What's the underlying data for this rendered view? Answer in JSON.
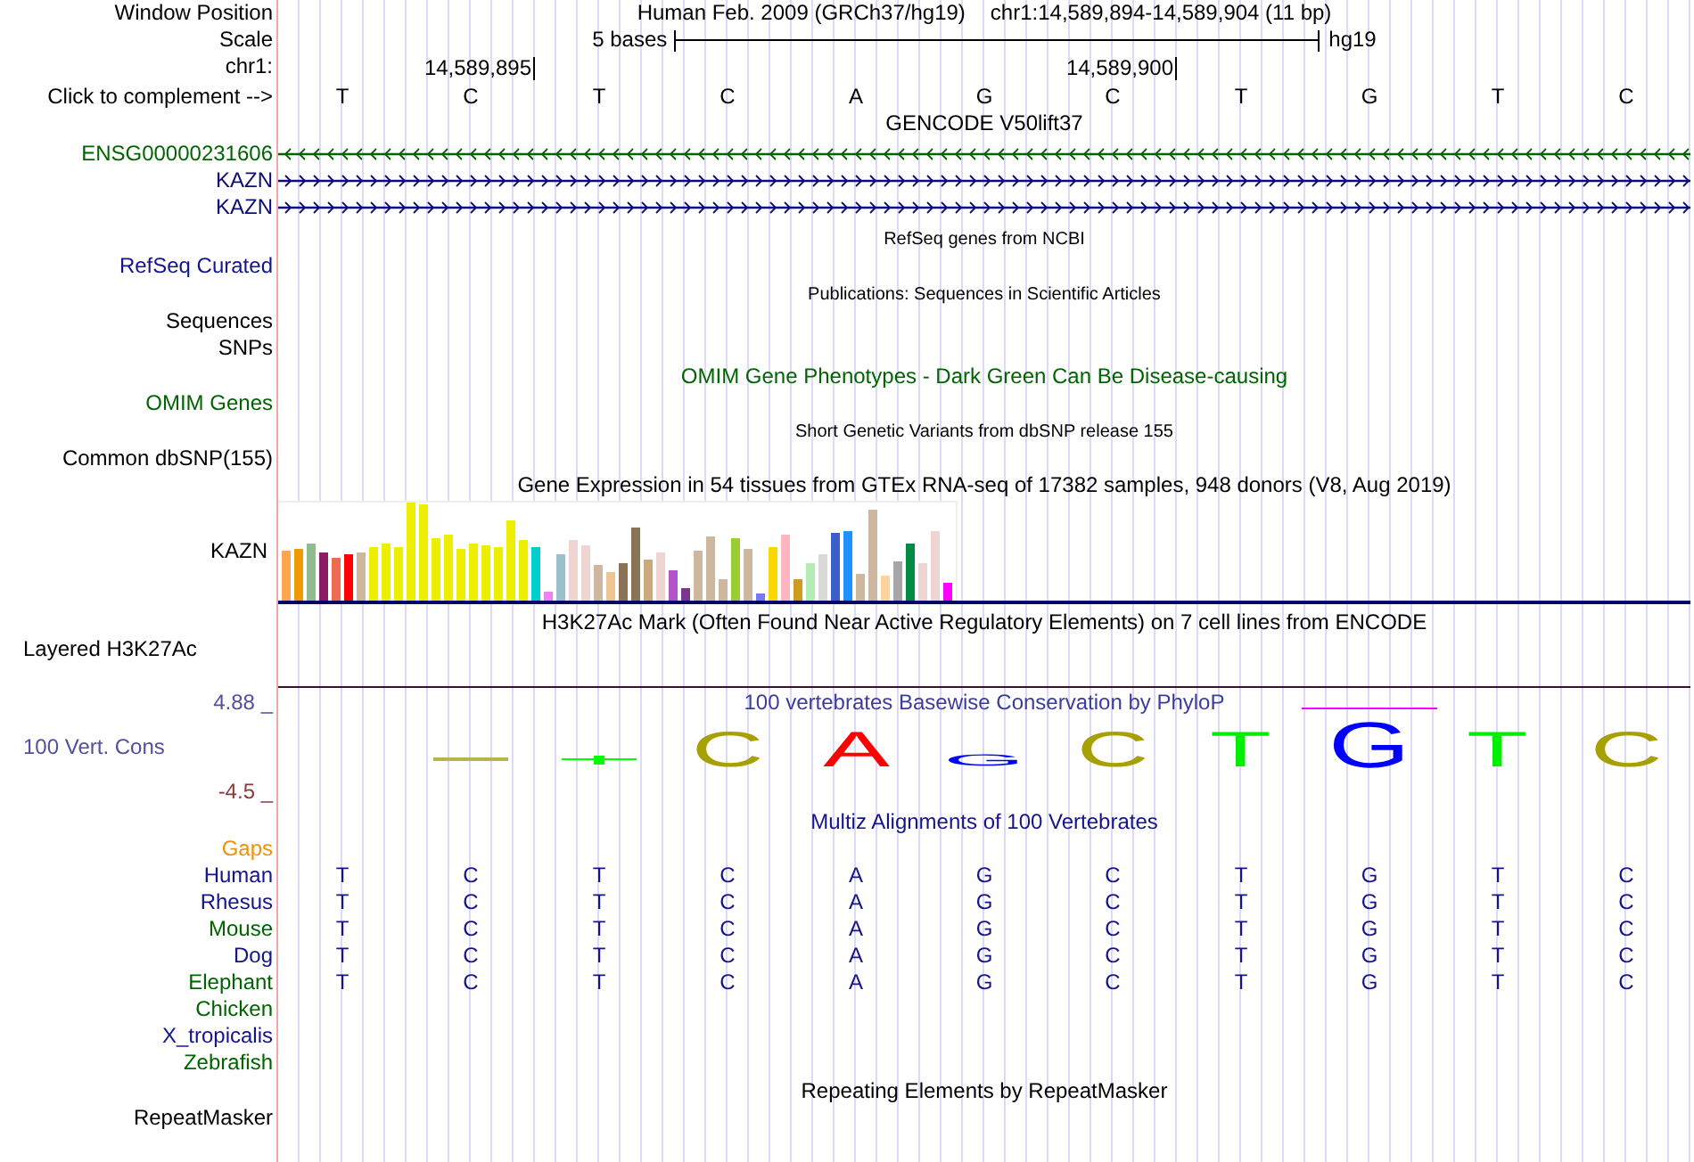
{
  "header": {
    "position_label": "Window Position",
    "assembly": "Human Feb. 2009 (GRCh37/hg19)",
    "position": "chr1:14,589,894-14,589,904 (11 bp)",
    "scale_label": "Scale",
    "scale_text": "5 bases",
    "scale_assembly": "hg19",
    "chrom_label": "chr1:",
    "ticks": [
      "14,589,895",
      "14,589,900"
    ],
    "complement_label": "Click to complement -->",
    "bases": [
      "T",
      "C",
      "T",
      "C",
      "A",
      "G",
      "C",
      "T",
      "G",
      "T",
      "C"
    ]
  },
  "tracks": [
    {
      "kind": "genes",
      "title": "GENCODE V50lift37",
      "genes": [
        {
          "name": "ENSG00000231606",
          "reverse": true,
          "color": "#006400"
        },
        {
          "name": "KAZN",
          "reverse": false,
          "color": "#0c0c78"
        },
        {
          "name": "KAZN",
          "reverse": false,
          "color": "#0c0c78"
        }
      ]
    },
    {
      "kind": "compact",
      "title": "RefSeq genes from NCBI",
      "labels": [
        {
          "text": "RefSeq Curated",
          "color": "#14148c"
        }
      ]
    },
    {
      "kind": "compact",
      "title": "Publications: Sequences in Scientific Articles",
      "labels": [
        {
          "text": "Sequences",
          "color": "#000000"
        },
        {
          "text": "SNPs",
          "color": "#000000"
        }
      ]
    },
    {
      "kind": "plain",
      "title": "OMIM Gene Phenotypes - Dark Green Can Be Disease-causing",
      "color": "#006400",
      "labels": [
        {
          "text": "OMIM Genes",
          "color": "#006400"
        }
      ]
    },
    {
      "kind": "compact",
      "title": "Short Genetic Variants from dbSNP release 155",
      "labels": [
        {
          "text": "Common dbSNP(155)",
          "color": "#000000"
        }
      ]
    },
    {
      "kind": "expression",
      "title": "Gene Expression in 54 tissues from GTEx RNA-seq of 17382 samples, 948 donors (V8, Aug 2019)",
      "labels": [
        {
          "text": "KAZN",
          "color": "#000000"
        }
      ]
    },
    {
      "kind": "signal",
      "title": "H3K27Ac Mark (Often Found Near Active Regulatory Elements) on 7 cell lines from ENCODE",
      "labels": [
        {
          "text": "Layered H3K27Ac",
          "color": "#000000"
        }
      ]
    },
    {
      "kind": "conservation",
      "title": "100 vertebrates Basewise Conservation by PhyloP",
      "color": "#3c3c9c",
      "labels": [
        {
          "text": "4.88 _",
          "color": "#5050a0"
        },
        {
          "text": "100 Vert. Cons",
          "color": "#5050a0"
        },
        {
          "text": "-4.5 _",
          "color": "#8b3a3a"
        }
      ],
      "logo": [
        {
          "kind": "blank"
        },
        {
          "kind": "dash",
          "color": "#b4b450",
          "peak": false
        },
        {
          "kind": "dash",
          "color": "#00ff00",
          "peak": true
        },
        {
          "kind": "letter",
          "letter": "C",
          "color": "#a8a000",
          "small": false,
          "large": false,
          "overline": false
        },
        {
          "kind": "letter",
          "letter": "A",
          "color": "#ff0000",
          "small": false,
          "large": false,
          "overline": false
        },
        {
          "kind": "letter",
          "letter": "G",
          "color": "#0000ff",
          "small": true,
          "large": false,
          "overline": false
        },
        {
          "kind": "letter",
          "letter": "C",
          "color": "#a8a000",
          "small": false,
          "large": false,
          "overline": false
        },
        {
          "kind": "letter",
          "letter": "T",
          "color": "#00ee00",
          "small": false,
          "large": false,
          "overline": false
        },
        {
          "kind": "letter",
          "letter": "G",
          "color": "#0000ff",
          "small": false,
          "large": true,
          "overline": true
        },
        {
          "kind": "letter",
          "letter": "T",
          "color": "#00ee00",
          "small": false,
          "large": false,
          "overline": false
        },
        {
          "kind": "letter",
          "letter": "C",
          "color": "#a8a000",
          "small": false,
          "large": false,
          "overline": false
        }
      ]
    },
    {
      "kind": "alignment",
      "title": "Multiz Alignments of 100 Vertebrates",
      "color": "#14148c",
      "species": [
        {
          "name": "Gaps",
          "color": "#f0900a"
        },
        {
          "name": "Human",
          "color": "#14148c",
          "bases": [
            "T",
            "C",
            "T",
            "C",
            "A",
            "G",
            "C",
            "T",
            "G",
            "T",
            "C"
          ]
        },
        {
          "name": "Rhesus",
          "color": "#14148c",
          "bases": [
            "T",
            "C",
            "T",
            "C",
            "A",
            "G",
            "C",
            "T",
            "G",
            "T",
            "C"
          ]
        },
        {
          "name": "Mouse",
          "color": "#006400",
          "bases": [
            "T",
            "C",
            "T",
            "C",
            "A",
            "G",
            "C",
            "T",
            "G",
            "T",
            "C"
          ]
        },
        {
          "name": "Dog",
          "color": "#14148c",
          "bases": [
            "T",
            "C",
            "T",
            "C",
            "A",
            "G",
            "C",
            "T",
            "G",
            "T",
            "C"
          ]
        },
        {
          "name": "Elephant",
          "color": "#006400",
          "bases": [
            "T",
            "C",
            "T",
            "C",
            "A",
            "G",
            "C",
            "T",
            "G",
            "T",
            "C"
          ]
        },
        {
          "name": "Chicken",
          "color": "#006400"
        },
        {
          "name": "X_tropicalis",
          "color": "#14148c"
        },
        {
          "name": "Zebrafish",
          "color": "#006400"
        }
      ]
    },
    {
      "kind": "plain",
      "title": "Repeating Elements by RepeatMasker",
      "labels": [
        {
          "text": "RepeatMasker",
          "color": "#000000"
        }
      ]
    }
  ]
}
